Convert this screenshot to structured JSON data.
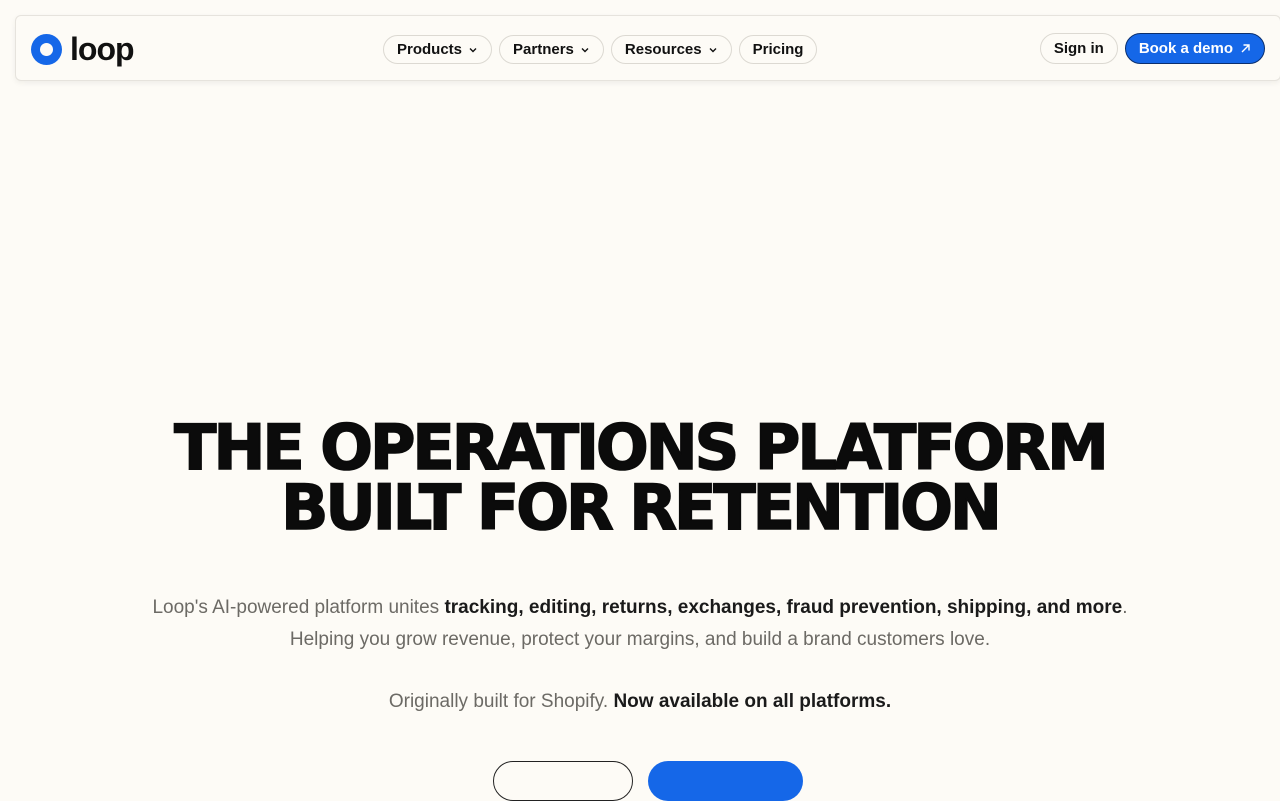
{
  "brand": {
    "name": "loop",
    "accent": "#1567e8"
  },
  "nav": {
    "items": [
      {
        "label": "Products",
        "has_dropdown": true
      },
      {
        "label": "Partners",
        "has_dropdown": true
      },
      {
        "label": "Resources",
        "has_dropdown": true
      },
      {
        "label": "Pricing",
        "has_dropdown": false
      }
    ],
    "sign_in": "Sign in",
    "book_demo": "Book a demo"
  },
  "hero": {
    "title_line1": "THE OPERATIONS PLATFORM",
    "title_line2": "BUILT FOR RETENTION",
    "sub_lead": "Loop's AI-powered platform unites ",
    "sub_bold": "tracking, editing, returns, exchanges, fraud prevention, shipping, and more",
    "sub_tail": ". Helping you grow revenue, protect your margins, and build a brand customers love.",
    "note_lead": "Originally built for Shopify. ",
    "note_bold": "Now available on all platforms."
  }
}
